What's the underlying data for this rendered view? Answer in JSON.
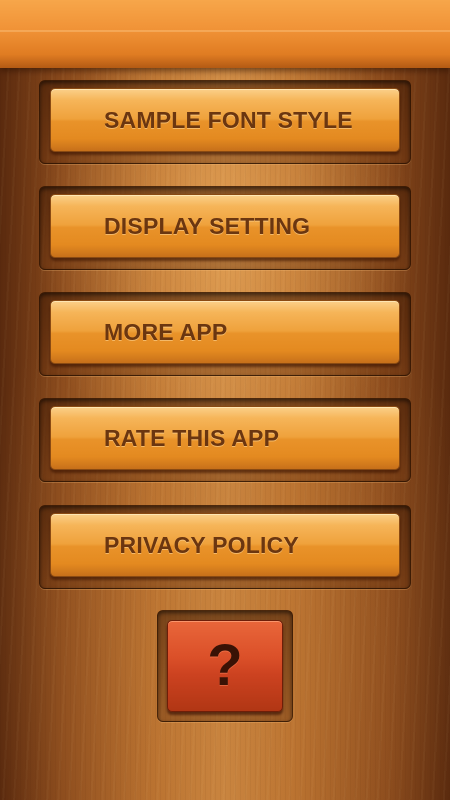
{
  "menu": {
    "items": [
      {
        "label": "SAMPLE FONT STYLE"
      },
      {
        "label": "DISPLAY SETTING"
      },
      {
        "label": "MORE APP"
      },
      {
        "label": "RATE THIS APP"
      },
      {
        "label": "PRIVACY POLICY"
      }
    ]
  },
  "help": {
    "icon": "question-mark-icon",
    "glyph": "?"
  },
  "colors": {
    "header": "#f09236",
    "button": "#efa23c",
    "button_text": "#6b3610",
    "help_button": "#db5029",
    "background": "#b9712f"
  }
}
